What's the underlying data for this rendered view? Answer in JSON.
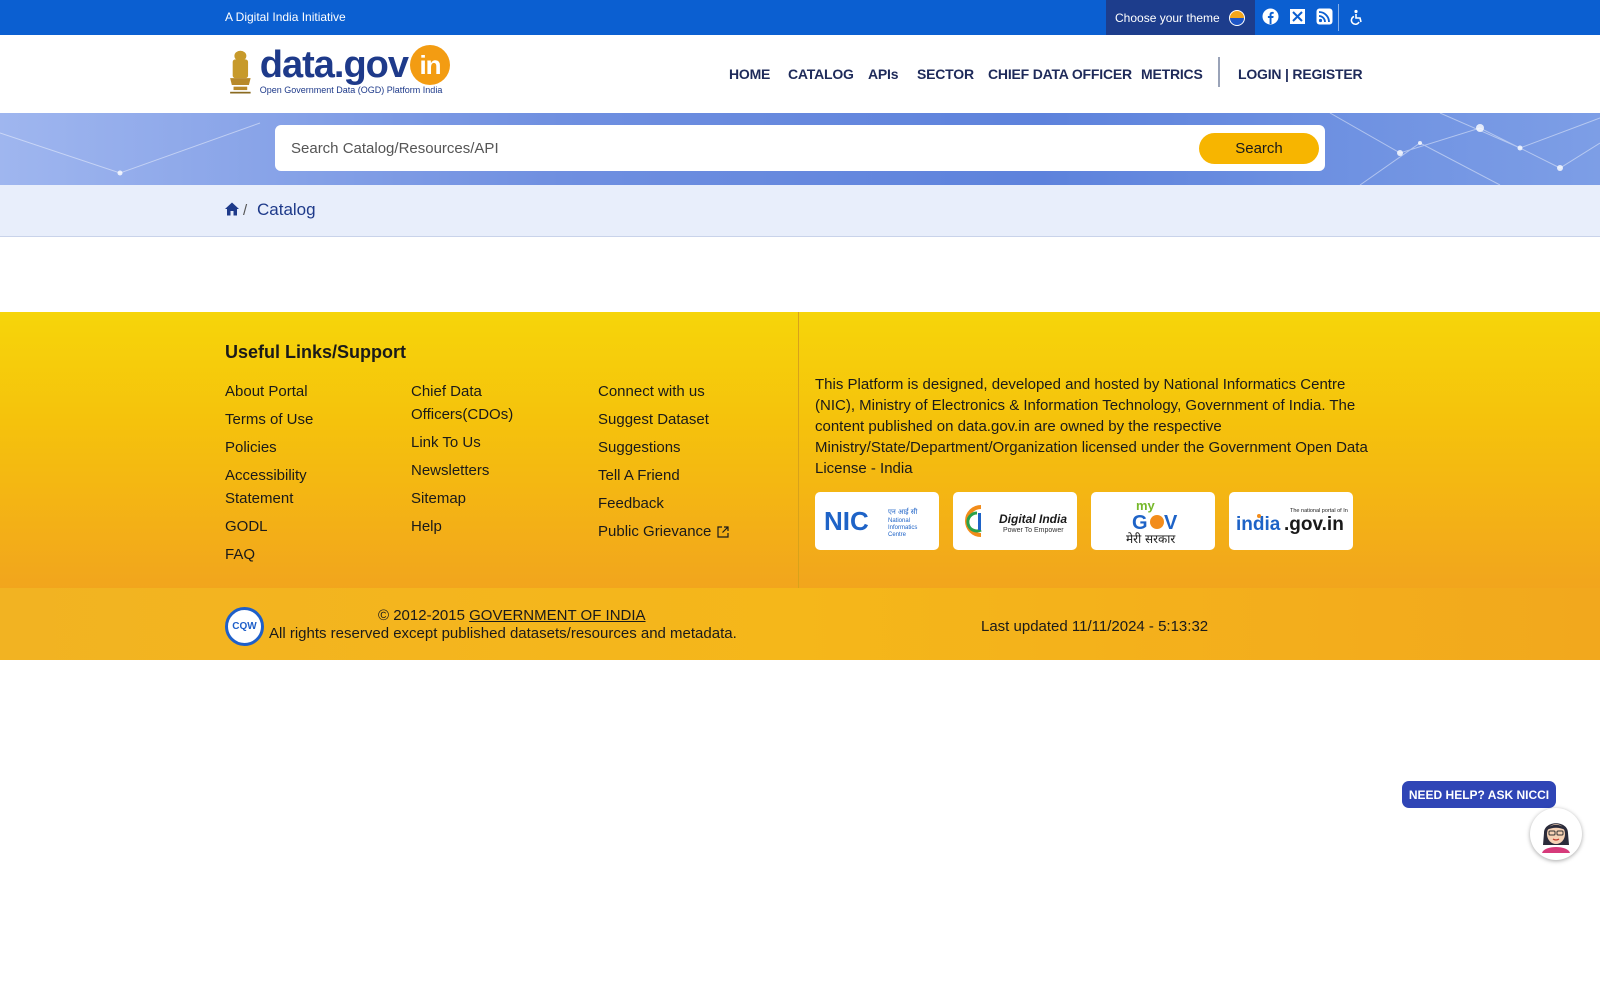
{
  "topbar": {
    "initiative": "A Digital India Initiative",
    "theme_label": "Choose your theme",
    "social_icons": [
      "facebook-icon",
      "x-icon",
      "rss-icon"
    ],
    "accessibility_icon": "accessibility-icon"
  },
  "header": {
    "logo_main": "data.gov",
    "logo_badge": "in",
    "logo_sub": "Open Government Data (OGD) Platform India",
    "nav": [
      "HOME",
      "CATALOG",
      "APIs",
      "SECTOR",
      "CHIEF DATA OFFICER",
      "METRICS"
    ],
    "login": "LOGIN | REGISTER"
  },
  "search": {
    "placeholder": "Search Catalog/Resources/API",
    "button": "Search"
  },
  "breadcrumb": {
    "current": "Catalog"
  },
  "footer": {
    "heading": "Useful Links/Support",
    "col1": [
      "About Portal",
      "Terms of Use",
      "Policies",
      "Accessibility Statement",
      "GODL",
      "FAQ"
    ],
    "col2": [
      "Chief Data Officers(CDOs)",
      "Link To Us",
      "Newsletters",
      "Sitemap",
      "Help"
    ],
    "col3": [
      "Connect with us",
      "Suggest Dataset",
      "Suggestions",
      "Tell A Friend",
      "Feedback",
      "Public Grievance"
    ],
    "about": "This Platform is designed, developed and hosted by National Informatics Centre (NIC), Ministry of Electronics & Information Technology, Government of India. The content published on data.gov.in are owned by the respective Ministry/State/Department/Organization licensed under the Government Open Data License - India",
    "partners": {
      "nic_text": "National Informatics Centre",
      "digital_india_title": "Digital India",
      "digital_india_tag": "Power To Empower",
      "mygov_hindi": "मेरी सरकार",
      "india_portal_tag": "The national portal of India",
      "india_portal": "india.gov.in"
    }
  },
  "copyright": {
    "prefix": "© 2012-2015",
    "org": "GOVERNMENT OF INDIA",
    "rights": "All rights reserved except published datasets/resources and metadata.",
    "updated": "Last updated 11/11/2024 - 5:13:32"
  },
  "chat": {
    "label": "NEED HELP? ASK NICCI"
  },
  "colors": {
    "topbar": "#0b5fd1",
    "nav_text": "#1e2a5a",
    "search_button": "#f7b500",
    "footer_yellow": "#f6d50a",
    "footer_orange": "#f2a51d"
  }
}
